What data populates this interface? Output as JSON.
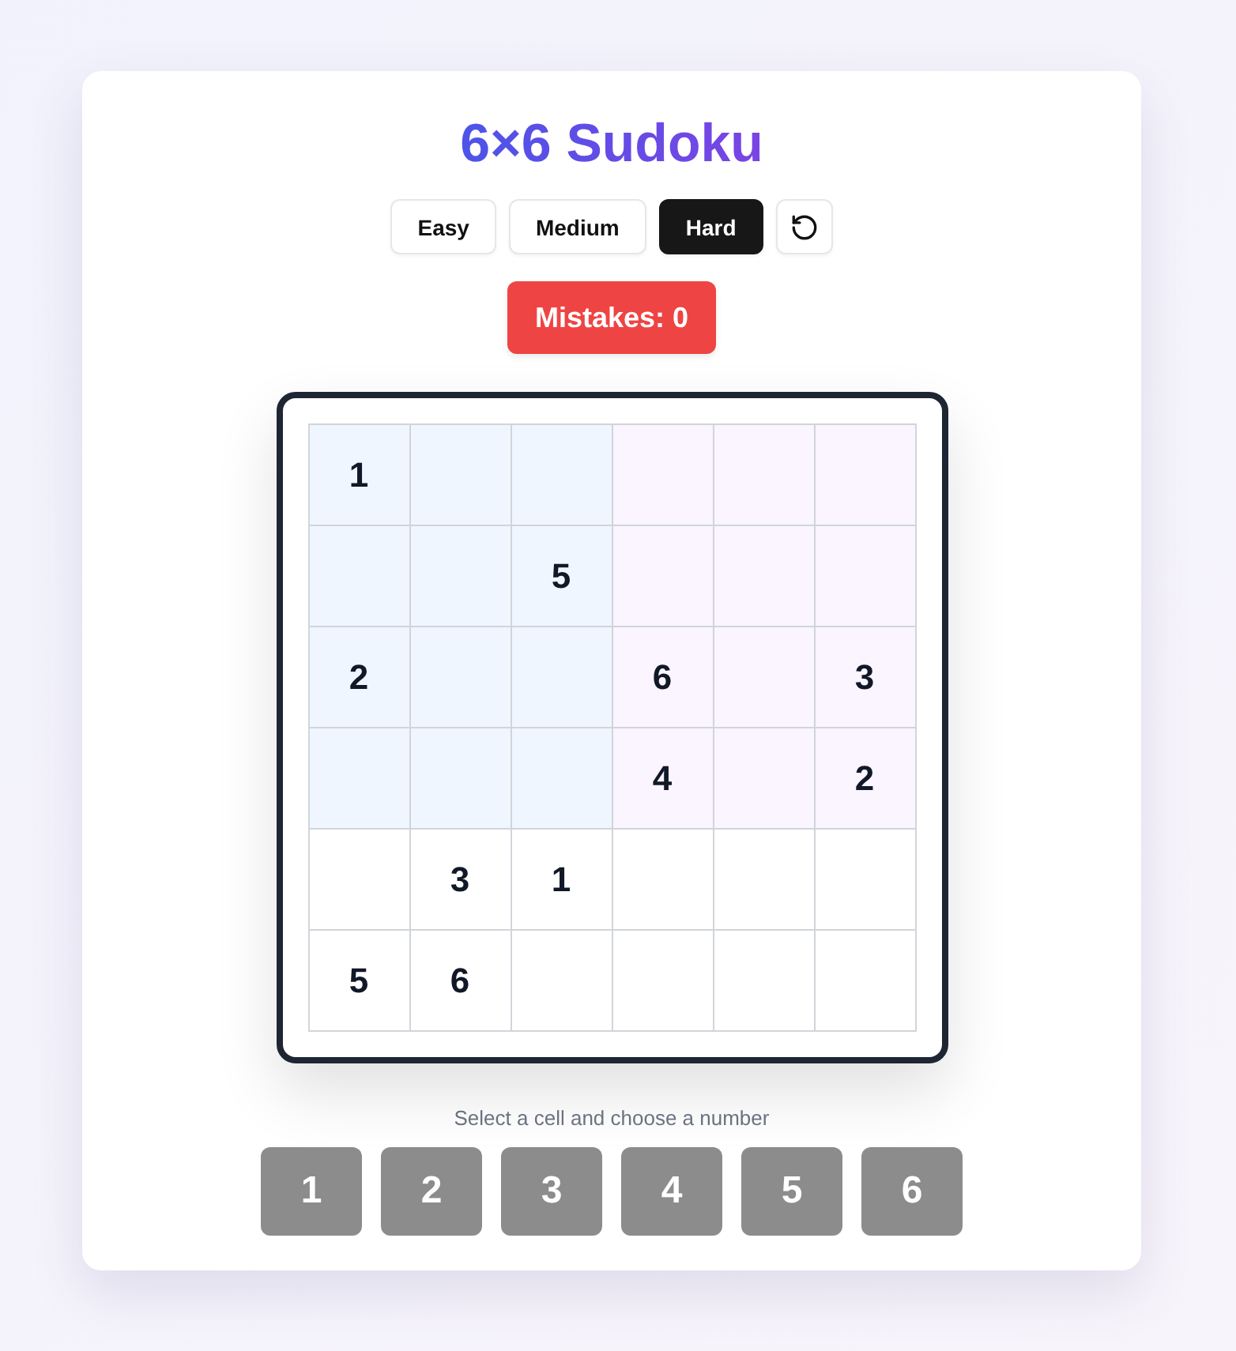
{
  "title": "6×6 Sudoku",
  "difficulty": [
    {
      "label": "Easy",
      "selected": false
    },
    {
      "label": "Medium",
      "selected": false
    },
    {
      "label": "Hard",
      "selected": true
    }
  ],
  "mistakes": "Mistakes: 0",
  "board": {
    "rows": [
      [
        {
          "value": "1",
          "color": "#eff6ff"
        },
        {
          "color": "#eff6ff"
        },
        {
          "color": "#eff6ff"
        },
        {
          "color": "#faf5ff"
        },
        {
          "color": "#faf5ff"
        },
        {
          "color": "#faf5ff"
        }
      ],
      [
        {
          "color": "#eff6ff"
        },
        {
          "color": "#eff6ff"
        },
        {
          "value": "5",
          "color": "#eff6ff"
        },
        {
          "color": "#faf5ff"
        },
        {
          "color": "#faf5ff"
        },
        {
          "color": "#faf5ff"
        }
      ],
      [
        {
          "value": "2",
          "color": "#eff6ff"
        },
        {
          "color": "#eff6ff"
        },
        {
          "color": "#eff6ff"
        },
        {
          "value": "6",
          "color": "#faf5ff"
        },
        {
          "color": "#faf5ff"
        },
        {
          "value": "3",
          "color": "#faf5ff"
        }
      ],
      [
        {
          "color": "#eff6ff"
        },
        {
          "color": "#eff6ff"
        },
        {
          "color": "#eff6ff"
        },
        {
          "value": "4",
          "color": "#faf5ff"
        },
        {
          "color": "#faf5ff"
        },
        {
          "value": "2",
          "color": "#faf5ff"
        }
      ],
      [
        {
          "color": "#ffffff"
        },
        {
          "value": "3",
          "color": "#ffffff"
        },
        {
          "value": "1",
          "color": "#ffffff"
        },
        {
          "color": "#ffffff"
        },
        {
          "color": "#ffffff"
        },
        {
          "color": "#ffffff"
        }
      ],
      [
        {
          "value": "5",
          "color": "#ffffff"
        },
        {
          "value": "6",
          "color": "#ffffff"
        },
        {
          "color": "#ffffff"
        },
        {
          "color": "#ffffff"
        },
        {
          "color": "#ffffff"
        },
        {
          "color": "#ffffff"
        }
      ]
    ]
  },
  "hint": "Select a cell and choose a number",
  "number_pad": [
    "1",
    "2",
    "3",
    "4",
    "5",
    "6"
  ]
}
